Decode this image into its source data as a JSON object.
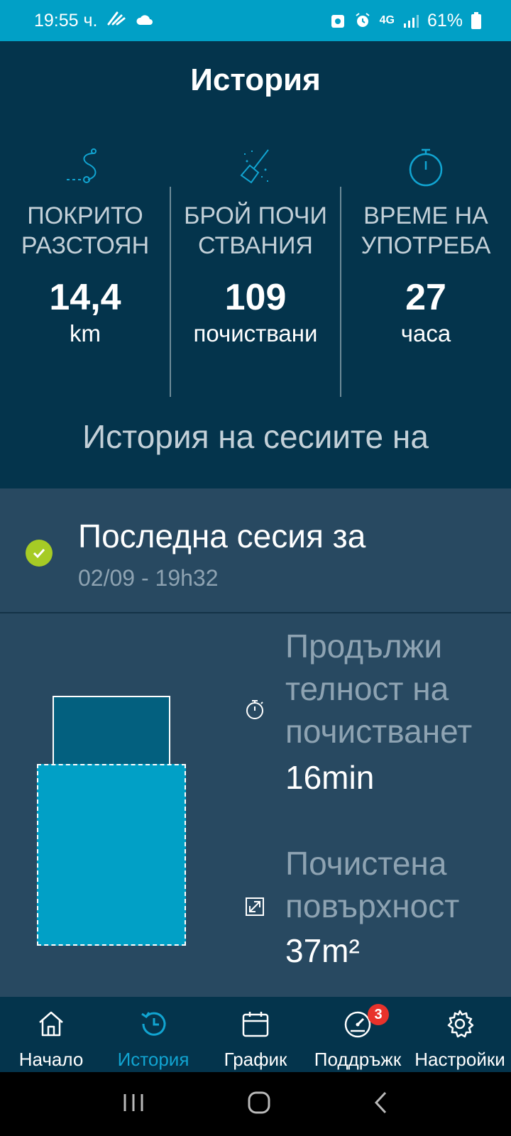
{
  "status_bar": {
    "time": "19:55 ч.",
    "network": "4G",
    "battery": "61%"
  },
  "page_title": "История",
  "stats": [
    {
      "label": "ПОКРИТО РАЗСТОЯН",
      "value": "14,4",
      "unit": "km",
      "icon": "route-icon"
    },
    {
      "label": "БРОЙ ПОЧИ СТВАНИЯ",
      "value": "109",
      "unit": "почиствани",
      "icon": "broom-icon"
    },
    {
      "label": "ВРЕМЕ НА УПОТРЕБА",
      "value": "27",
      "unit": "часа",
      "icon": "stopwatch-icon"
    }
  ],
  "history_subtitle": "История на сесиите на",
  "session": {
    "title": "Последна сесия за",
    "date": "02/09 - 19h32",
    "duration_label": "Продължи телност на почистванет",
    "duration_value": "16min",
    "surface_label": "Почистена повърхност",
    "surface_value": "37m²"
  },
  "nav": {
    "home": "Начало",
    "history": "История",
    "schedule": "График",
    "support": "Поддръжк",
    "support_badge": "3",
    "settings": "Настройки"
  },
  "colors": {
    "status_bar": "#01a0c6",
    "background": "#04344c",
    "session_panel": "#284961",
    "accent": "#11a4d1",
    "check": "#a6cb25",
    "badge": "#e8322b"
  }
}
